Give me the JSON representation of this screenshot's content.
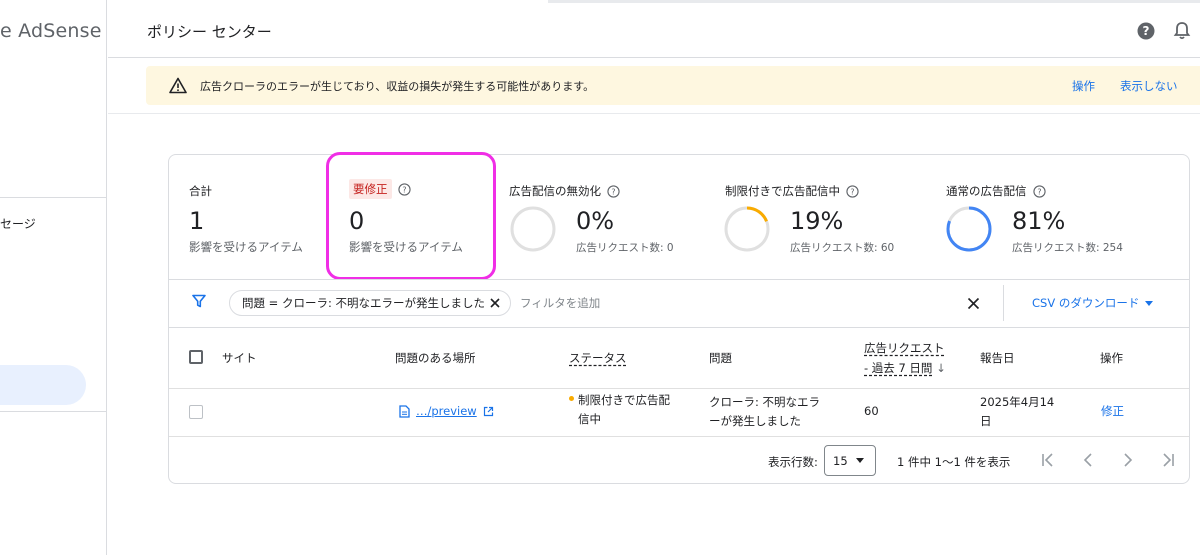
{
  "app": {
    "logo_text": "e AdSense"
  },
  "sidebar": {
    "message_item": "セージ"
  },
  "header": {
    "title": "ポリシー センター",
    "help_icon": "help-circle-icon",
    "bell_icon": "bell-icon"
  },
  "banner": {
    "text": "広告クローラのエラーが生じており、収益の損失が発生する可能性があります。",
    "action": "操作",
    "dismiss": "表示しない"
  },
  "stats": {
    "total": {
      "label": "合計",
      "value": "1",
      "sub": "影響を受けるアイテム"
    },
    "needs_fix": {
      "label": "要修正",
      "value": "0",
      "sub": "影響を受けるアイテム"
    },
    "disabled": {
      "label": "広告配信の無効化",
      "value": "0%",
      "sub": "広告リクエスト数: 0",
      "fraction": 0
    },
    "limited": {
      "label": "制限付きで広告配信中",
      "value": "19%",
      "sub": "広告リクエスト数: 60",
      "fraction": 0.19,
      "color": "#f9ab00"
    },
    "normal": {
      "label": "通常の広告配信",
      "value": "81%",
      "sub": "広告リクエスト数: 254",
      "fraction": 0.81,
      "color": "#4285f4"
    }
  },
  "filter": {
    "chip": "問題 = クローラ: 不明なエラーが発生しました",
    "placeholder": "フィルタを追加",
    "csv": "CSV のダウンロード"
  },
  "table": {
    "headers": {
      "site": "サイト",
      "location": "問題のある場所",
      "status": "ステータス",
      "issue": "問題",
      "requests_1": "広告リクエスト",
      "requests_2": "- 過去 7 日間",
      "sort_arrow": "↓",
      "date": "報告日",
      "action": "操作"
    },
    "rows": [
      {
        "site": "",
        "location": "…/preview",
        "status_1": "制限付きで広告配",
        "status_2": "信中",
        "issue_1": "クローラ: 不明なエラ",
        "issue_2": "ーが発生しました",
        "requests": "60",
        "date_1": "2025年4月14",
        "date_2": "日",
        "action": "修正"
      }
    ]
  },
  "footer": {
    "rows_label": "表示行数:",
    "rows_value": "15",
    "range": "1 件中 1〜1 件を表示"
  }
}
